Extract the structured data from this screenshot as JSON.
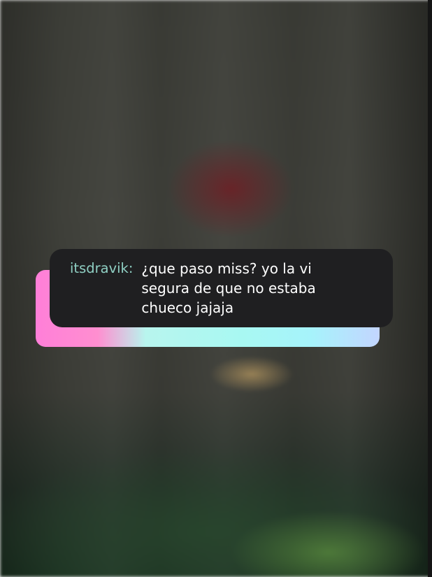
{
  "comment": {
    "username": "itsdravik:",
    "message": "¿que paso miss? yo la vi\nsegura de que no estaba\nchueco jajaja"
  },
  "colors": {
    "username": "#8fcfc3",
    "bubble_background": "#1f1f21",
    "message_text": "#ffffff",
    "gradient_start": "#ff7fd8",
    "gradient_mid": "#a8f8f2",
    "gradient_end": "#c3d5ff"
  }
}
